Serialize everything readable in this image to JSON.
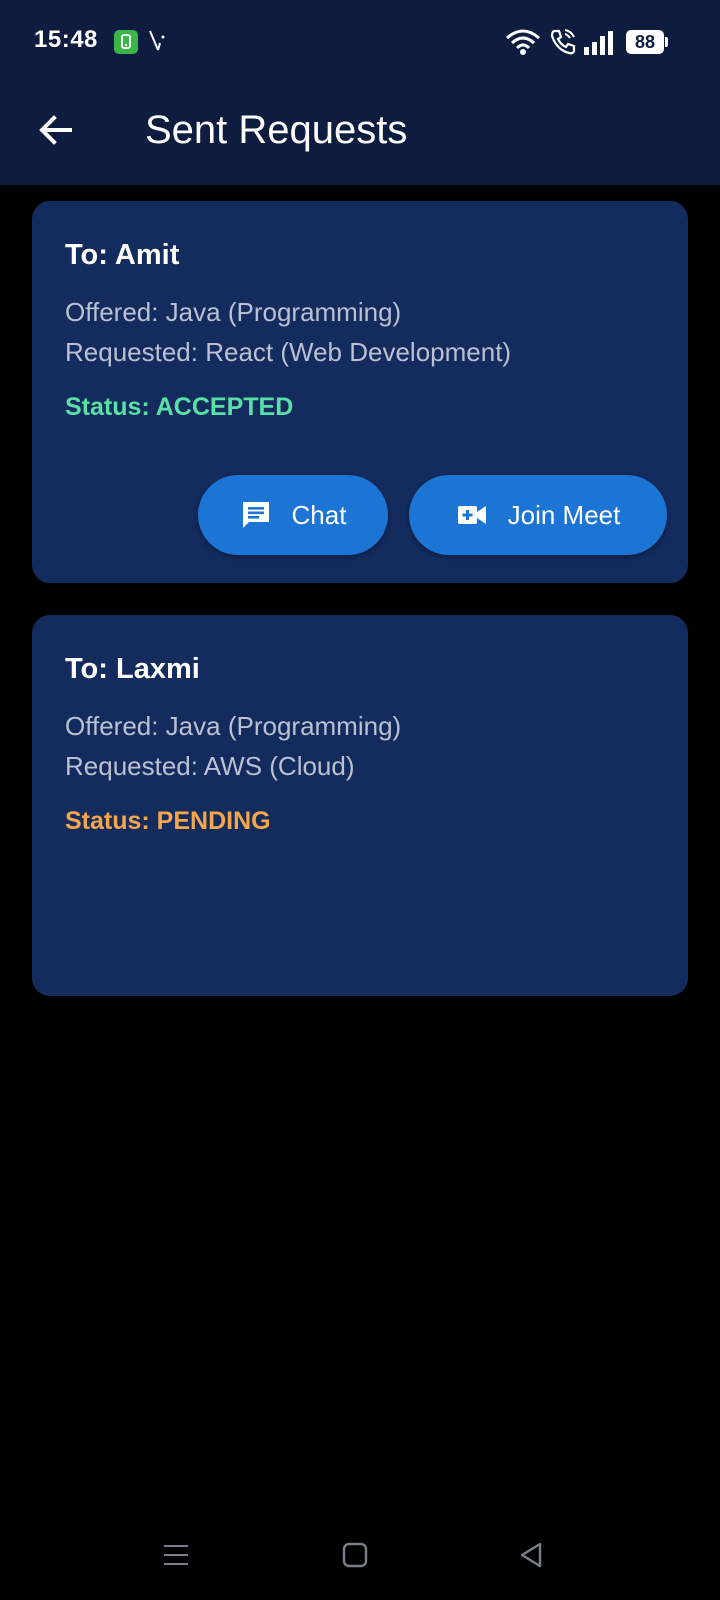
{
  "status_bar": {
    "time": "15:48",
    "battery": "88",
    "icons": [
      "app-icon",
      "v-icon",
      "wifi-icon",
      "call-icon",
      "signal-icon",
      "battery-icon"
    ]
  },
  "app_bar": {
    "title": "Sent Requests",
    "back_icon": "arrow-left-icon"
  },
  "requests": [
    {
      "to": "To: Amit",
      "offered": "Offered: Java (Programming)",
      "requested": "Requested: React (Web Development)",
      "status": "Status: ACCEPTED",
      "status_color": "#58e0a6",
      "actions": [
        {
          "label": "Chat",
          "icon": "chat-icon"
        },
        {
          "label": "Join Meet",
          "icon": "video-add-icon"
        }
      ]
    },
    {
      "to": "To: Laxmi",
      "offered": "Offered: Java (Programming)",
      "requested": "Requested: AWS (Cloud)",
      "status": "Status: PENDING",
      "status_color": "#f5a54a",
      "actions": []
    }
  ],
  "colors": {
    "app_bar": "#0e1c3f",
    "card": "#132b5d",
    "button": "#1c74d4",
    "background": "#000000"
  },
  "nav_bar": {
    "icons": [
      "menu-icon",
      "home-square-icon",
      "back-triangle-icon"
    ]
  }
}
